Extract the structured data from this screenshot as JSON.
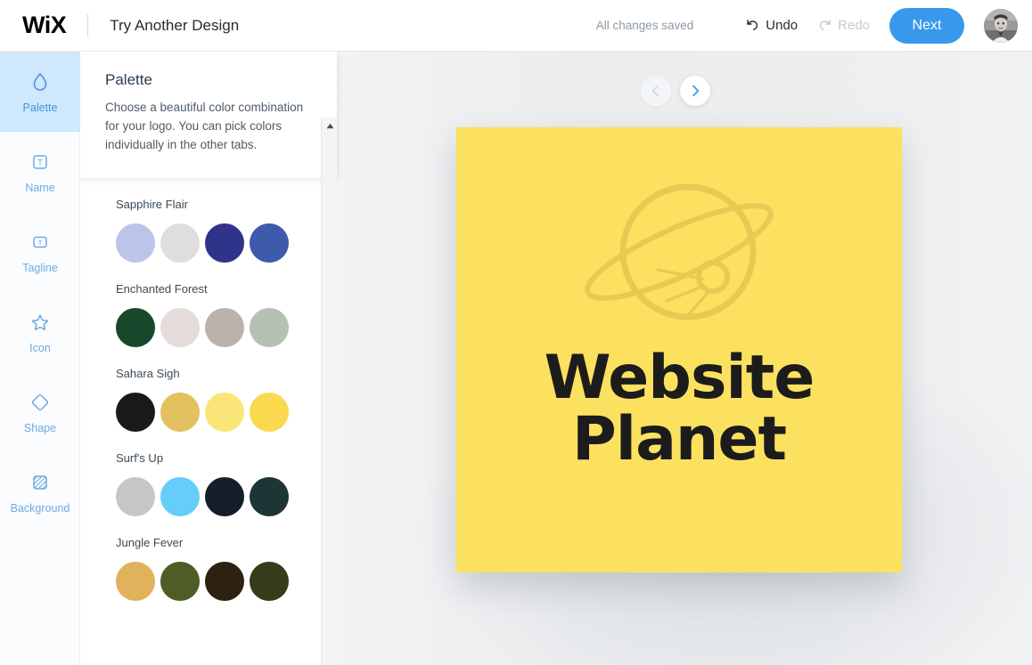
{
  "header": {
    "brand": "WiX",
    "title": "Try Another Design",
    "saved_status": "All changes saved",
    "undo_label": "Undo",
    "redo_label": "Redo",
    "next_label": "Next",
    "next_color": "#3899ec",
    "avatar_name": "user-avatar"
  },
  "sidebar": {
    "items": [
      {
        "label": "Palette",
        "icon": "droplet-icon",
        "active": true
      },
      {
        "label": "Name",
        "icon": "text-box-icon",
        "active": false
      },
      {
        "label": "Tagline",
        "icon": "text-box-small-icon",
        "active": false
      },
      {
        "label": "Icon",
        "icon": "star-icon",
        "active": false
      },
      {
        "label": "Shape",
        "icon": "diamond-icon",
        "active": false
      },
      {
        "label": "Background",
        "icon": "hatched-square-icon",
        "active": false
      }
    ],
    "active_color": "#cfe8fb",
    "text_color": "#6ea9e0"
  },
  "panel": {
    "title": "Palette",
    "description": "Choose a beautiful color combination for your logo. You can pick colors individually in the other tabs."
  },
  "palettes": [
    {
      "name": "",
      "partial": true,
      "colors": [
        "#d8bb8c",
        "#c4763a",
        "#fbeecd",
        "#fbe2b5"
      ]
    },
    {
      "name": "Sapphire Flair",
      "partial": false,
      "colors": [
        "#bcc4e8",
        "#dedede",
        "#30338a",
        "#3d5aad"
      ]
    },
    {
      "name": "Enchanted Forest",
      "partial": false,
      "colors": [
        "#17482c",
        "#e4dcdb",
        "#bdb1ab",
        "#b7c0b4"
      ]
    },
    {
      "name": "Sahara Sigh",
      "partial": false,
      "colors": [
        "#1a1a1a",
        "#e3c060",
        "#fae578",
        "#fbd94e"
      ]
    },
    {
      "name": "Surf's Up",
      "partial": false,
      "colors": [
        "#c6c6c6",
        "#66ccfa",
        "#141f2b",
        "#1d3535"
      ]
    },
    {
      "name": "Jungle Fever",
      "partial": false,
      "colors": [
        "#e0b25c",
        "#4e5c26",
        "#2e2112",
        "#343c1a"
      ]
    }
  ],
  "canvas": {
    "prev_icon": "chevron-left-icon",
    "next_icon": "chevron-right-icon",
    "logo": {
      "background_color": "#fbe15f",
      "icon_name": "saturn-planet-icon",
      "icon_color": "#e7ca52",
      "text_color": "#1c1c1c",
      "line1": "Website",
      "line2": "Planet"
    }
  }
}
